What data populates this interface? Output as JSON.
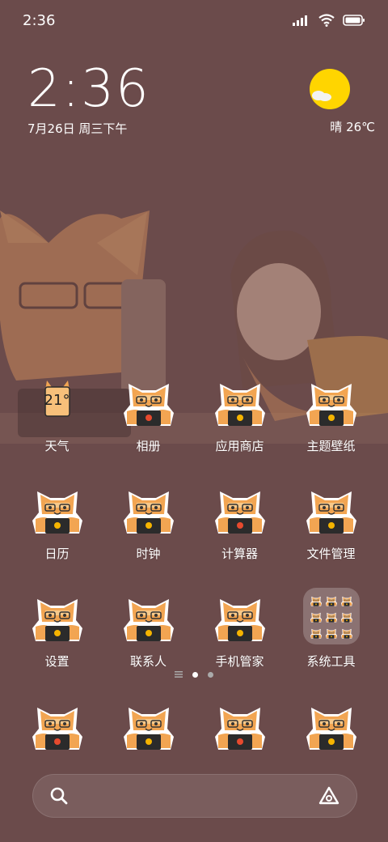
{
  "status_bar": {
    "time": "2:36"
  },
  "clock": {
    "time": "2:36",
    "date": "7月26日 周三下午"
  },
  "weather": {
    "label": "晴 26℃",
    "icon": "sun-cloud-icon"
  },
  "weather_app": {
    "temp": "21°",
    "label": "天气"
  },
  "apps": [
    {
      "label": "相册",
      "emblem": "photo",
      "color": "#e64a2e"
    },
    {
      "label": "应用商店",
      "emblem": "store",
      "color": "#f5b400"
    },
    {
      "label": "主题壁纸",
      "emblem": "theme",
      "color": "#f5b400"
    },
    {
      "label": "日历",
      "emblem": "calendar",
      "color": "#f5b400"
    },
    {
      "label": "时钟",
      "emblem": "clock",
      "color": "#f5b400"
    },
    {
      "label": "计算器",
      "emblem": "calculator",
      "color": "#e64a2e"
    },
    {
      "label": "文件管理",
      "emblem": "files",
      "color": "#f5b400"
    },
    {
      "label": "设置",
      "emblem": "gear",
      "color": "#f5b400"
    },
    {
      "label": "联系人",
      "emblem": "contact",
      "color": "#f5b400"
    },
    {
      "label": "手机管家",
      "emblem": "shield",
      "color": "#f5b400"
    }
  ],
  "folder": {
    "label": "系统工具"
  },
  "dock": [
    {
      "name": "phone",
      "emblem": "phone",
      "color": "#e64a2e"
    },
    {
      "name": "messages",
      "emblem": "message",
      "color": "#f5b400"
    },
    {
      "name": "browser",
      "emblem": "browser",
      "color": "#e64a2e"
    },
    {
      "name": "camera",
      "emblem": "camera",
      "color": "#f5b400"
    }
  ],
  "colors": {
    "background": "#6b4b4b",
    "cat_orange": "#f2a552",
    "weather_sun": "#ffd500"
  }
}
